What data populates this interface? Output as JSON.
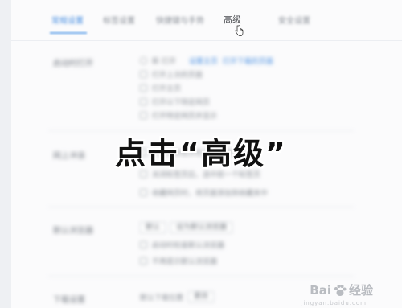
{
  "tabs": [
    {
      "label": "常规设置",
      "active": true
    },
    {
      "label": "标签设置",
      "active": false
    },
    {
      "label": "快捷键与手势",
      "active": false
    },
    {
      "label": "高级",
      "active": false
    },
    {
      "label": "安全设置",
      "active": false
    }
  ],
  "sections": {
    "startup": {
      "label": "启动时打开",
      "options": [
        "新 打开",
        "打开上次的页面",
        "打开主页",
        "打开以下特定网页",
        "打开特定网页并显示"
      ],
      "links": [
        "设置主页",
        "打开下载的页面"
      ]
    },
    "tabs_behavior": {
      "label": "网上冲浪",
      "options": [
        "打开新标签页在当前标签页右侧",
        "关闭标签页后，选中前一个标签页",
        "收藏网页时，将页面添加到收藏夹中"
      ]
    },
    "default_browser": {
      "label": "默认浏览器",
      "select_value": "默认",
      "button_label": "设为默认浏览器",
      "options": [
        "启动时检查默认浏览器",
        "不再提示默认浏览器"
      ]
    },
    "download": {
      "label": "下载设置",
      "value": "默认下载位置",
      "button_label": "更改"
    }
  },
  "overlay_caption": "点击“高级”",
  "watermark": {
    "brand": "Bai",
    "brand_suffix": "经验",
    "sub": "jingyan.baidu.com"
  },
  "colors": {
    "accent": "#4a90e2",
    "overlay_text": "#111111"
  }
}
